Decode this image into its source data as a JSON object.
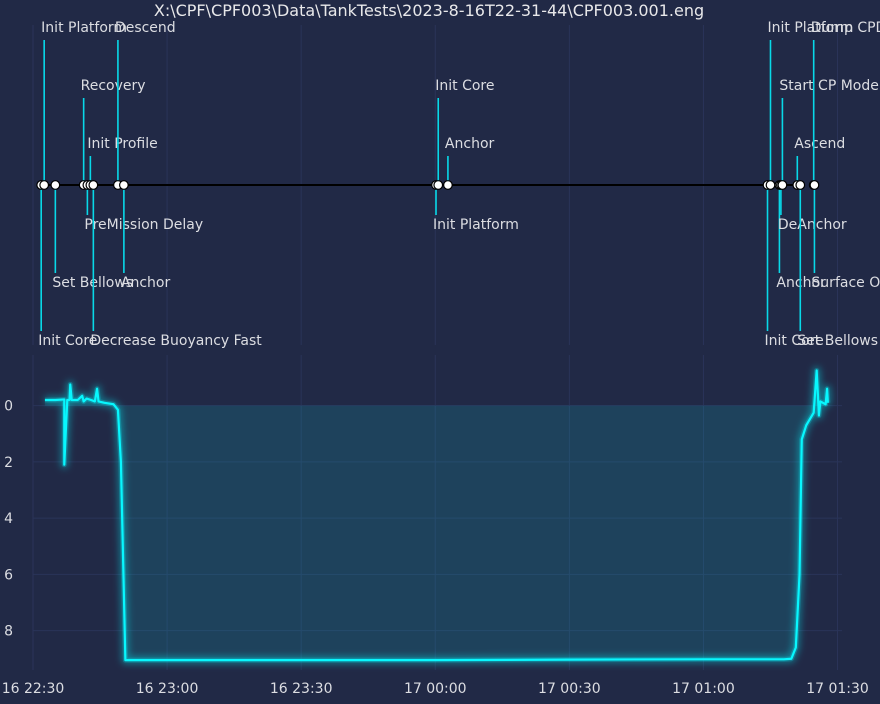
{
  "chart_data": [
    {
      "type": "timeline",
      "title": "X:\\CPF\\CPF003\\Data\\TankTests\\2023-8-16T22-31-44\\CPF003.001.eng",
      "events": [
        {
          "label": "Init Core",
          "time": "2023-08-16 22:31:50",
          "level": -3
        },
        {
          "label": "Init Platform",
          "time": "2023-08-16 22:32:30",
          "level": 3
        },
        {
          "label": "Set Bellows",
          "time": "2023-08-16 22:35:00",
          "level": -2
        },
        {
          "label": "Recovery",
          "time": "2023-08-16 22:41:20",
          "level": 2
        },
        {
          "label": "PreMission Delay",
          "time": "2023-08-16 22:42:10",
          "level": -1
        },
        {
          "label": "Init Profile",
          "time": "2023-08-16 22:42:50",
          "level": 1
        },
        {
          "label": "Decrease Buoyancy Fast",
          "time": "2023-08-16 22:43:30",
          "level": -3
        },
        {
          "label": "Descend",
          "time": "2023-08-16 22:49:00",
          "level": 3
        },
        {
          "label": "Anchor",
          "time": "2023-08-16 22:50:20",
          "level": -2
        },
        {
          "label": "Init Platform",
          "time": "2023-08-17 00:00:10",
          "level": -1
        },
        {
          "label": "Init Core",
          "time": "2023-08-17 00:00:40",
          "level": 2
        },
        {
          "label": "Anchor",
          "time": "2023-08-17 00:02:50",
          "level": 1
        },
        {
          "label": "Init Core",
          "time": "2023-08-17 01:14:20",
          "level": -3
        },
        {
          "label": "Init Platform",
          "time": "2023-08-17 01:15:00",
          "level": 3
        },
        {
          "label": "Anchor",
          "time": "2023-08-17 01:17:00",
          "level": -2
        },
        {
          "label": "DeAnchor",
          "time": "2023-08-17 01:17:20",
          "level": -1
        },
        {
          "label": "Start CP Mode",
          "time": "2023-08-17 01:17:40",
          "level": 2
        },
        {
          "label": "Ascend",
          "time": "2023-08-17 01:21:00",
          "level": 1
        },
        {
          "label": "Set Bellows",
          "time": "2023-08-17 01:21:40",
          "level": -3
        },
        {
          "label": "Dump CPData",
          "time": "2023-08-17 01:24:40",
          "level": 3
        },
        {
          "label": "Surface Ops",
          "time": "2023-08-17 01:24:50",
          "level": -2
        }
      ]
    },
    {
      "type": "area",
      "x_tick_labels": [
        "16 22:30",
        "16 23:00",
        "16 23:30",
        "17 00:00",
        "17 00:30",
        "17 01:00",
        "17 01:30"
      ],
      "x_ticks": [
        "2023-08-16 22:30",
        "2023-08-16 23:00",
        "2023-08-16 23:30",
        "2023-08-17 00:00",
        "2023-08-17 00:30",
        "2023-08-17 01:00",
        "2023-08-17 01:30"
      ],
      "xlim": [
        "2023-08-16 22:30",
        "2023-08-17 01:31"
      ],
      "y_tick_labels": [
        "0",
        "2",
        "4",
        "6",
        "8"
      ],
      "y_ticks": [
        0,
        2,
        4,
        6,
        8
      ],
      "ylim": [
        9.4,
        -1.8
      ],
      "y_inverted": true,
      "grid": true,
      "series": [
        {
          "color": "#08F7FE",
          "points": [
            [
              "2023-08-16 22:32:40",
              -0.2
            ],
            [
              "2023-08-16 22:35:00",
              -0.2
            ],
            [
              "2023-08-16 22:37:00",
              -0.22
            ],
            [
              "2023-08-16 22:37:00",
              2.1
            ],
            [
              "2023-08-16 22:37:40",
              -0.2
            ],
            [
              "2023-08-16 22:38:10",
              -0.2
            ],
            [
              "2023-08-16 22:38:20",
              -0.75
            ],
            [
              "2023-08-16 22:38:40",
              -0.2
            ],
            [
              "2023-08-16 22:40:00",
              -0.2
            ],
            [
              "2023-08-16 22:41:00",
              -0.35
            ],
            [
              "2023-08-16 22:41:20",
              -0.15
            ],
            [
              "2023-08-16 22:42:00",
              -0.25
            ],
            [
              "2023-08-16 22:43:00",
              -0.2
            ],
            [
              "2023-08-16 22:43:50",
              -0.15
            ],
            [
              "2023-08-16 22:44:20",
              -0.6
            ],
            [
              "2023-08-16 22:44:40",
              -0.15
            ],
            [
              "2023-08-16 22:46:00",
              -0.1
            ],
            [
              "2023-08-16 22:48:00",
              -0.05
            ],
            [
              "2023-08-16 22:49:00",
              0.15
            ],
            [
              "2023-08-16 22:49:40",
              2.0
            ],
            [
              "2023-08-16 22:50:40",
              9.05
            ],
            [
              "2023-08-16 23:30:00",
              9.05
            ],
            [
              "2023-08-17 00:00:00",
              9.05
            ],
            [
              "2023-08-17 00:30:00",
              9.03
            ],
            [
              "2023-08-17 01:00:00",
              9.02
            ],
            [
              "2023-08-17 01:18:00",
              9.02
            ],
            [
              "2023-08-17 01:19:40",
              9.0
            ],
            [
              "2023-08-17 01:20:40",
              8.6
            ],
            [
              "2023-08-17 01:21:30",
              6.0
            ],
            [
              "2023-08-17 01:22:00",
              1.2
            ],
            [
              "2023-08-17 01:23:00",
              0.7
            ],
            [
              "2023-08-17 01:24:40",
              0.25
            ],
            [
              "2023-08-17 01:25:00",
              -0.5
            ],
            [
              "2023-08-17 01:25:20",
              -1.25
            ],
            [
              "2023-08-17 01:25:40",
              -0.2
            ],
            [
              "2023-08-17 01:25:50",
              0.35
            ],
            [
              "2023-08-17 01:26:10",
              -0.15
            ],
            [
              "2023-08-17 01:27:20",
              -0.05
            ],
            [
              "2023-08-17 01:27:40",
              -0.6
            ],
            [
              "2023-08-17 01:27:50",
              -0.1
            ]
          ]
        }
      ]
    }
  ]
}
